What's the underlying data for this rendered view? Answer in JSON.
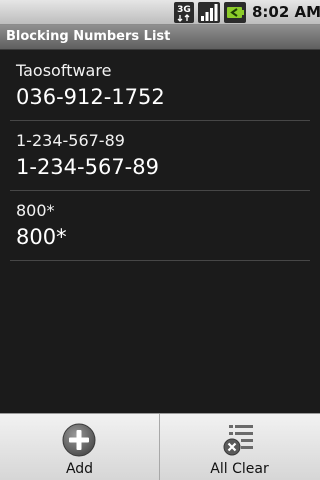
{
  "status_bar": {
    "time": "8:02 AM",
    "network_label": "3G",
    "icons": [
      "network-3g-icon",
      "signal-strength-icon",
      "battery-icon"
    ]
  },
  "title_bar": {
    "title": "Blocking Numbers List"
  },
  "list": {
    "items": [
      {
        "name": "Taosoftware",
        "number": "036-912-1752"
      },
      {
        "name": "1-234-567-89",
        "number": "1-234-567-89"
      },
      {
        "name": "800*",
        "number": "800*"
      }
    ]
  },
  "bottom_bar": {
    "add_label": "Add",
    "add_icon": "add-circle-icon",
    "clear_label": "All Clear",
    "clear_icon": "clear-list-icon"
  },
  "colors": {
    "background": "#1b1b1b",
    "title_bar": "#777777",
    "bottom_bar": "#e4e4e4",
    "battery_accent": "#8ccc2a"
  }
}
